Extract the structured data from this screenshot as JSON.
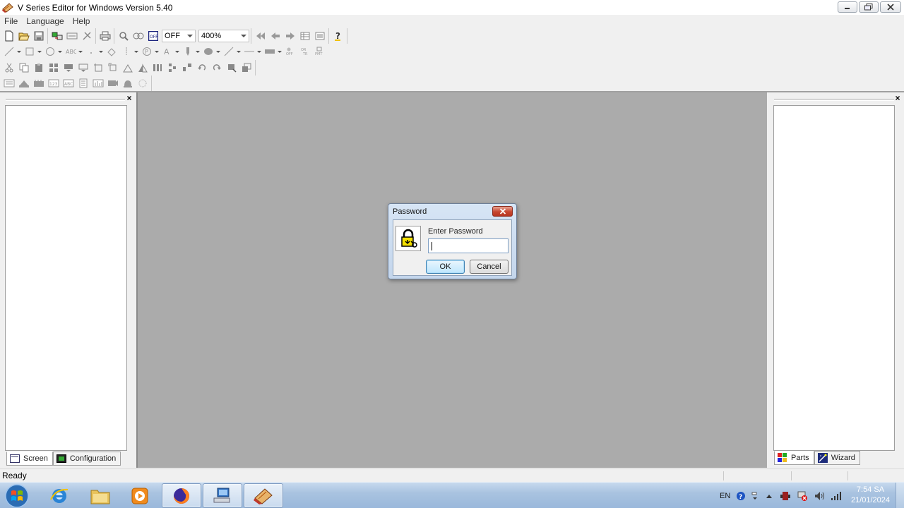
{
  "window": {
    "title": "V Series Editor for Windows Version 5.40"
  },
  "menu": [
    "File",
    "Language",
    "Help"
  ],
  "toolbar": {
    "onoff_value": "OFF",
    "zoom_value": "400%"
  },
  "left_panel": {
    "close_label": "×",
    "tabs": [
      {
        "label": "Screen",
        "icon": "screen-icon"
      },
      {
        "label": "Configuration",
        "icon": "configuration-icon"
      }
    ]
  },
  "right_panel": {
    "close_label": "×",
    "tabs": [
      {
        "label": "Parts",
        "icon": "parts-icon"
      },
      {
        "label": "Wizard",
        "icon": "wizard-icon"
      }
    ]
  },
  "dialog": {
    "title": "Password",
    "prompt": "Enter Password",
    "password_value": "",
    "ok_label": "OK",
    "cancel_label": "Cancel"
  },
  "status": {
    "text": "Ready"
  },
  "taskbar": {
    "language": "EN",
    "time": "7:54 SA",
    "date": "21/01/2024"
  }
}
